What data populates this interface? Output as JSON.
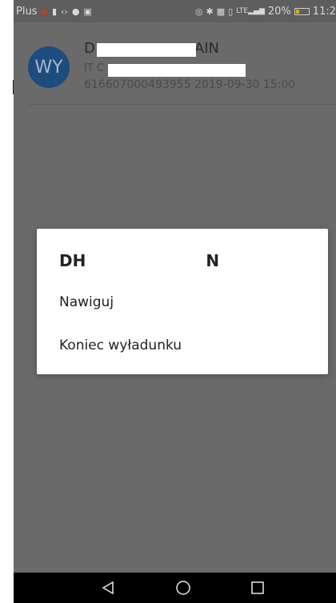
{
  "status_bar": {
    "carrier": "Plus",
    "battery_percent": "20%",
    "time": "11:2",
    "network_label": "LTE"
  },
  "list_item": {
    "avatar_initials": "WY",
    "title_prefix": "D",
    "title_suffix": "AIN",
    "subtitle_prefix": "IT C",
    "meta": "616607000493955 2019-09-30 15:00"
  },
  "dialog": {
    "title_prefix": "DH",
    "title_suffix": "N",
    "items": [
      {
        "label": "Nawiguj"
      },
      {
        "label": "Koniec wyładunku"
      }
    ]
  },
  "colors": {
    "avatar_bg": "#1d4c7e",
    "overlay": "#6a6a6a"
  },
  "icons": {
    "nav": [
      "back-icon",
      "home-icon",
      "recents-icon"
    ]
  }
}
